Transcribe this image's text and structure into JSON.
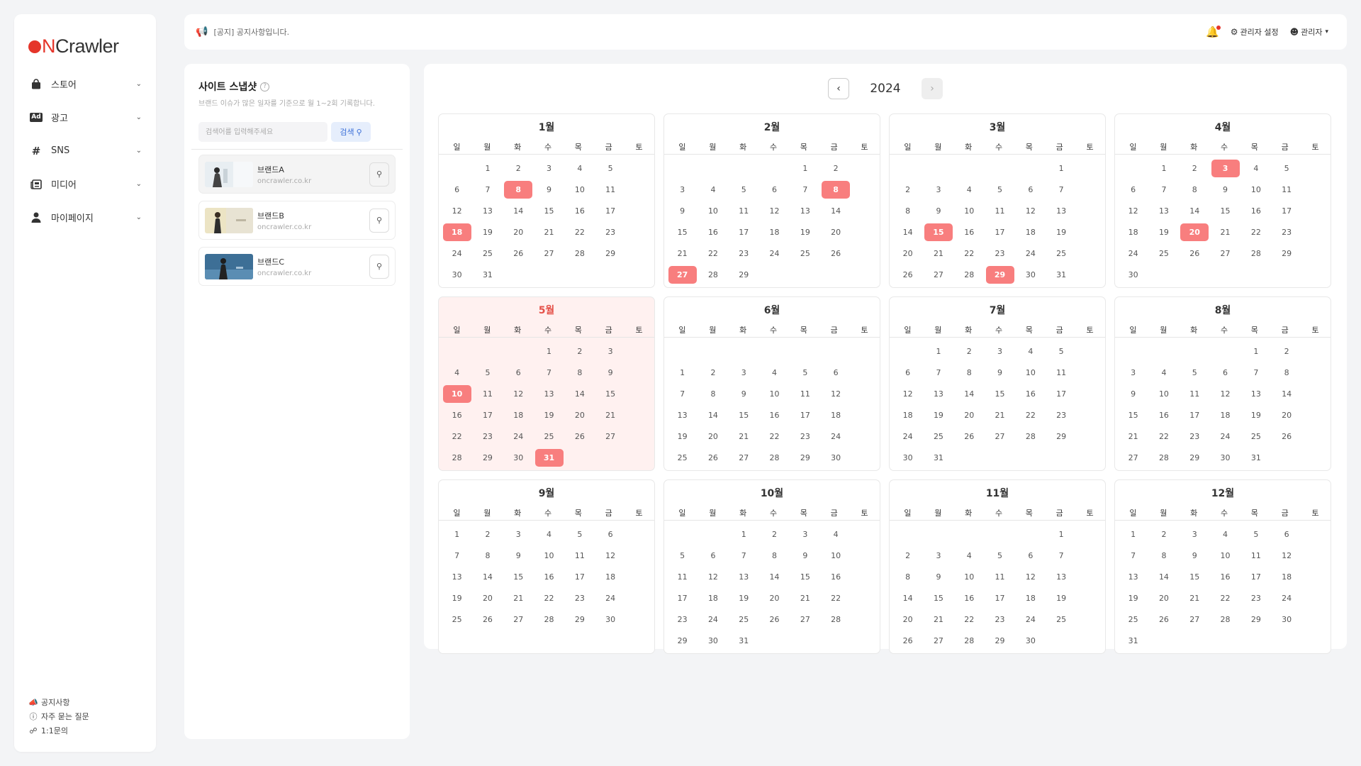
{
  "sidebar": {
    "logo": {
      "prefix": "N",
      "rest": "Crawler"
    },
    "items": [
      {
        "label": "스토어",
        "icon": "shopping-bag-icon"
      },
      {
        "label": "광고",
        "icon": "ad-badge-icon",
        "badge": "Ad"
      },
      {
        "label": "SNS",
        "icon": "hash-icon",
        "glyph": "#"
      },
      {
        "label": "미디어",
        "icon": "newspaper-icon"
      },
      {
        "label": "마이페이지",
        "icon": "user-icon"
      }
    ],
    "footer": [
      {
        "label": "공지사항",
        "icon": "megaphone-icon"
      },
      {
        "label": "자주 묻는 질문",
        "icon": "info-icon"
      },
      {
        "label": "1:1문의",
        "icon": "headset-icon"
      }
    ]
  },
  "topbar": {
    "notice": "[공지] 공지사항입니다.",
    "admin_settings": "관리자 설정",
    "user": "관리자"
  },
  "snapshot": {
    "title": "사이트 스냅샷",
    "subtitle": "브랜드 이슈가 많은 일자를 기준으로 월 1~2회 기록합니다.",
    "search_placeholder": "검색어를 입력해주세요",
    "search_value": "",
    "search_button": "검색",
    "brands": [
      {
        "name": "브랜드A",
        "url": "oncrawler.co.kr"
      },
      {
        "name": "브랜드B",
        "url": "oncrawler.co.kr"
      },
      {
        "name": "브랜드C",
        "url": "oncrawler.co.kr"
      }
    ]
  },
  "calendar": {
    "year": "2024",
    "weekdays": [
      "일",
      "월",
      "화",
      "수",
      "목",
      "금",
      "토"
    ],
    "current_month_index": 4,
    "months": [
      {
        "title": "1월",
        "start": 1,
        "days": 31,
        "highlight": [
          8,
          18
        ]
      },
      {
        "title": "2월",
        "start": 4,
        "days": 29,
        "highlight": [
          8,
          27
        ]
      },
      {
        "title": "3월",
        "start": 5,
        "days": 31,
        "highlight": [
          15,
          29
        ]
      },
      {
        "title": "4월",
        "start": 1,
        "days": 30,
        "highlight": [
          3,
          20
        ]
      },
      {
        "title": "5월",
        "start": 3,
        "days": 31,
        "highlight": [
          10,
          31
        ]
      },
      {
        "title": "6월",
        "start": 6,
        "days": 30,
        "highlight": []
      },
      {
        "title": "7월",
        "start": 1,
        "days": 31,
        "highlight": []
      },
      {
        "title": "8월",
        "start": 4,
        "days": 31,
        "highlight": []
      },
      {
        "title": "9월",
        "start": 0,
        "days": 30,
        "highlight": []
      },
      {
        "title": "10월",
        "start": 2,
        "days": 31,
        "highlight": []
      },
      {
        "title": "11월",
        "start": 5,
        "days": 30,
        "highlight": []
      },
      {
        "title": "12월",
        "start": 0,
        "days": 31,
        "highlight": []
      }
    ]
  },
  "colors": {
    "brand_red": "#e5352a",
    "highlight": "#f87e7e",
    "current_month_bg": "#fff1f0",
    "current_month_title": "#e5524a"
  }
}
